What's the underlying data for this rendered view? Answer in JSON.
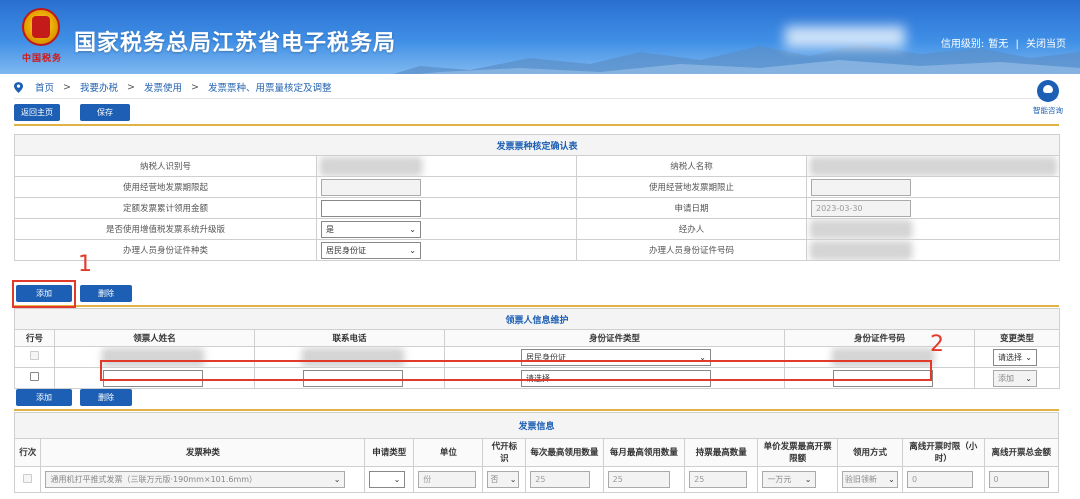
{
  "header": {
    "site_title": "国家税务总局江苏省电子税务局",
    "motto": "中国税务",
    "credit_label": "信用级别:",
    "credit_value": "暂无",
    "divider": "|",
    "close_label": "关闭当页"
  },
  "breadcrumb": {
    "items": [
      "首页",
      "我要办税",
      "发票使用",
      "发票票种、用票量核定及调整"
    ],
    "separator": ">"
  },
  "help": {
    "label": "智能咨询"
  },
  "toolbar": {
    "home_label": "返回主页",
    "save_label": "保存"
  },
  "confirm_table": {
    "caption": "发票票种核定确认表",
    "rows": [
      {
        "left_label": "纳税人识别号",
        "right_label": "纳税人名称"
      },
      {
        "left_label": "使用经营地发票期限起",
        "right_label": "使用经营地发票期限止"
      },
      {
        "left_label": "定额发票累计领用金额",
        "right_label": "申请日期",
        "right_value": "2023-03-30"
      },
      {
        "left_label": "是否使用增值税发票系统升级版",
        "left_value": "是",
        "right_label": "经办人"
      },
      {
        "left_label": "办理人员身份证件种类",
        "left_value": "居民身份证",
        "right_label": "办理人员身份证件号码"
      }
    ]
  },
  "recipient_buttons": {
    "add_label": "添加",
    "delete_label": "删除"
  },
  "recipient_table": {
    "caption": "领票人信息维护",
    "headers": [
      "行号",
      "领票人姓名",
      "联系电话",
      "身份证件类型",
      "身份证件号码",
      "变更类型"
    ],
    "rows": [
      {
        "id_type": "居民身份证",
        "change_type": "请选择"
      },
      {
        "id_type": "请选择",
        "change_type": "添加"
      }
    ]
  },
  "invoice_buttons": {
    "add_label": "添加",
    "delete_label": "删除"
  },
  "invoice_table": {
    "caption": "发票信息",
    "headers": [
      "行次",
      "发票种类",
      "申请类型",
      "单位",
      "代开标识",
      "每次最高领用数量",
      "每月最高领用数量",
      "持票最高数量",
      "单价发票最高开票限额",
      "领用方式",
      "离线开票时限（小时）",
      "离线开票总金额"
    ],
    "row": {
      "invoice_type": "通用机打平推式发票（三联万元版·190mm×101.6mm）",
      "apply_type": "",
      "unit": "份",
      "agent_flag": "否",
      "per_time_max": "25",
      "per_month_max": "25",
      "hold_max": "25",
      "unit_limit": "一万元",
      "receive_method": "验旧领新",
      "offline_hours": "0",
      "offline_amount": "0"
    }
  },
  "annotations": {
    "one": "1",
    "two": "2"
  },
  "colors": {
    "brand_blue": "#1d5fb4",
    "gold": "#e1b347",
    "annot_red": "#e23a2a"
  }
}
